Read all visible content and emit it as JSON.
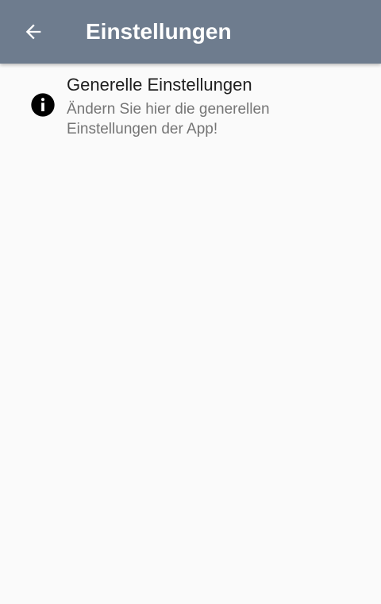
{
  "app_bar": {
    "title": "Einstellungen",
    "back_icon": "arrow-back-icon",
    "color": "#6e7c8e"
  },
  "preferences": [
    {
      "icon": "info-icon",
      "title": "Generelle Einstellungen",
      "summary": "Ändern Sie hier die generellen Einstellungen der App!"
    }
  ]
}
